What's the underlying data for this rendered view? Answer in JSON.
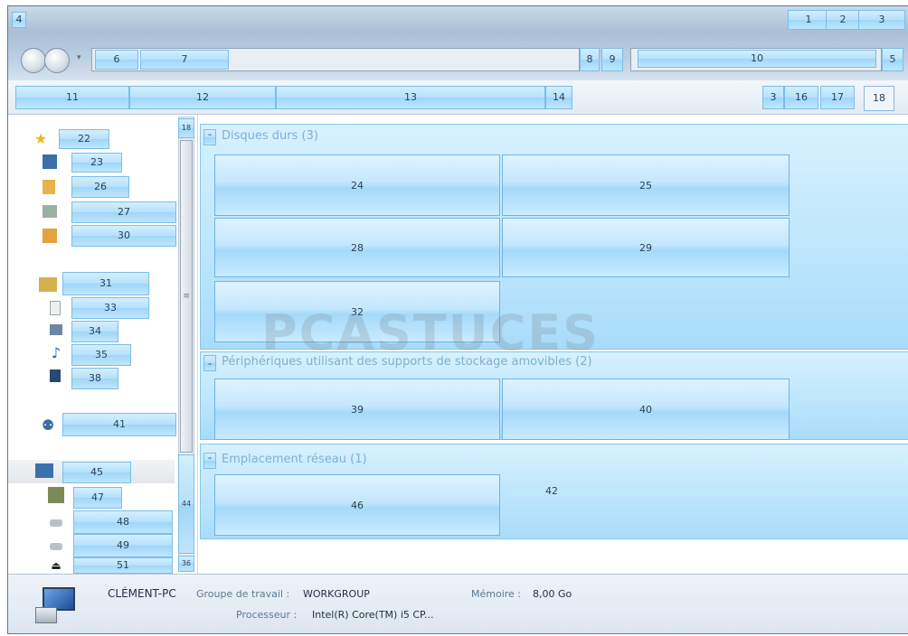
{
  "markers": {
    "m1": "1",
    "m2": "2",
    "m3": "3",
    "m4": "4",
    "m5": "5",
    "m6": "6",
    "m7": "7",
    "m8": "8",
    "m9": "9",
    "m10": "10",
    "m11": "11",
    "m12": "12",
    "m13": "13",
    "m14": "14",
    "m16": "16",
    "m17": "17",
    "m18": "18",
    "m18b": "18",
    "m22": "22",
    "m23": "23",
    "m24": "24",
    "m25": "25",
    "m26": "26",
    "m27": "27",
    "m28": "28",
    "m29": "29",
    "m30": "30",
    "m31": "31",
    "m32": "32",
    "m33": "33",
    "m34": "34",
    "m35": "35",
    "m36": "36",
    "m38": "38",
    "m39": "39",
    "m40": "40",
    "m41": "41",
    "m42": "42",
    "m44": "44",
    "m45": "45",
    "m46": "46",
    "m47": "47",
    "m48": "48",
    "m49": "49",
    "m51": "51"
  },
  "groups": {
    "hard_disks": "Disques durs (3)",
    "removable": "Périphériques utilisant des supports de stockage amovibles (2)",
    "network": "Emplacement réseau (1)"
  },
  "status": {
    "computer_name": "CLÉMENT-PC",
    "workgroup_label": "Groupe de travail :",
    "workgroup_value": "WORKGROUP",
    "memory_label": "Mémoire :",
    "memory_value": "8,00 Go",
    "processor_label": "Processeur :",
    "processor_value": "Intel(R) Core(TM) i5 CP..."
  },
  "watermark": "PCASTUCES",
  "colors": {
    "highlight": "#a9dcfa",
    "border": "#6fb4e2",
    "text": "#2c4257"
  }
}
